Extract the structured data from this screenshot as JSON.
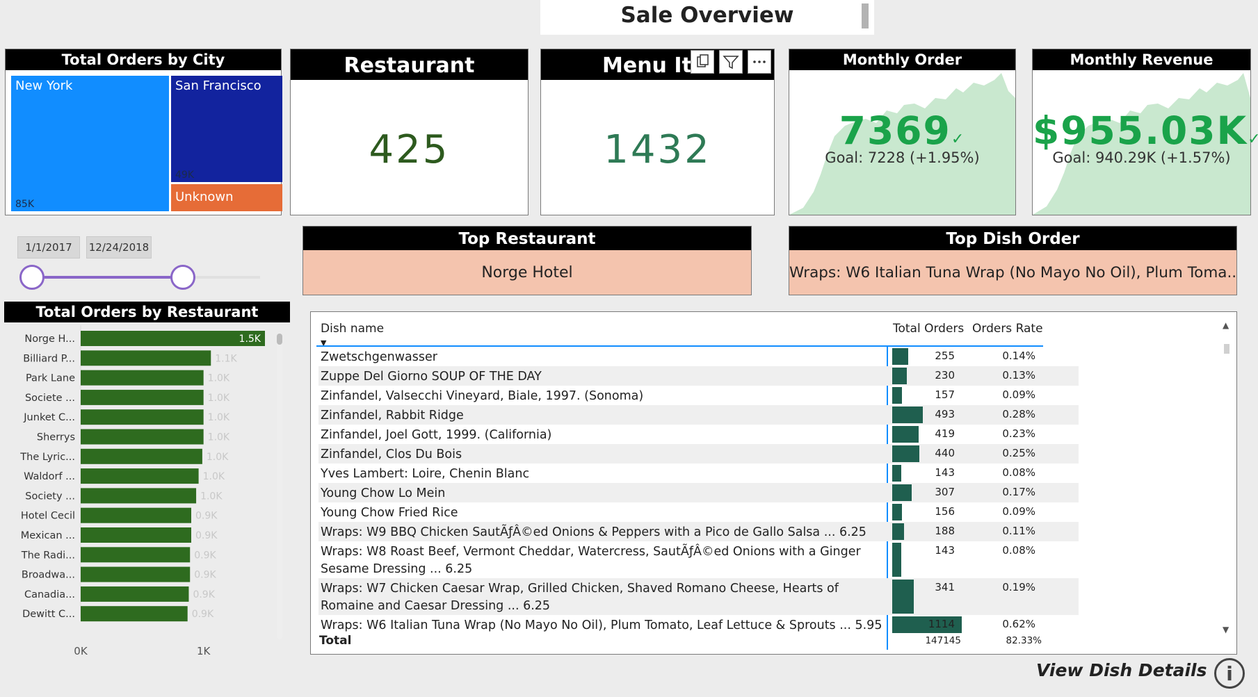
{
  "title": "Sale Overview",
  "treemap": {
    "title": "Total Orders by City",
    "cells": [
      {
        "name": "New York",
        "value": "85K",
        "color": "#118dff"
      },
      {
        "name": "San Francisco",
        "value": "49K",
        "color": "#12239e"
      },
      {
        "name": "Unknown",
        "value": "",
        "color": "#e66c37"
      }
    ]
  },
  "kpis": {
    "restaurant": {
      "label": "Restaurant",
      "value": "425"
    },
    "menu_item": {
      "label": "Menu Ite",
      "value": "1432"
    }
  },
  "toolbar": {
    "icons": [
      "copy-icon",
      "filter-icon",
      "more-options-icon"
    ]
  },
  "monthly_order": {
    "label": "Monthly Order",
    "value": "7369",
    "goal": "Goal: 7228 (+1.95%)",
    "check": "✓"
  },
  "monthly_revenue": {
    "label": "Monthly Revenue",
    "value": "$955.03K",
    "goal": "Goal: 940.29K (+1.57%)",
    "check": "✓"
  },
  "date_slicer": {
    "start": "1/1/2017",
    "end": "12/24/2018"
  },
  "top_restaurant": {
    "label": "Top Restaurant",
    "value": "Norge Hotel"
  },
  "top_dish": {
    "label": "Top Dish Order",
    "value": "Wraps: W6  Italian Tuna Wrap (No Mayo No Oil), Plum Toma..."
  },
  "chart_data": {
    "type": "bar",
    "title": "Total Orders by Restaurant",
    "orientation": "horizontal",
    "categories": [
      "Norge H...",
      "Billiard P...",
      "Park Lane",
      "Societe ...",
      "Junket C...",
      "Sherrys",
      "The Lyric...",
      "Waldorf ...",
      "Society ...",
      "Hotel Cecil",
      "Mexican ...",
      "The Radi...",
      "Broadwa...",
      "Canadia...",
      "Dewitt C..."
    ],
    "values": [
      1500,
      1060,
      1000,
      1000,
      1000,
      1000,
      990,
      960,
      940,
      900,
      900,
      890,
      890,
      880,
      870
    ],
    "data_labels": [
      "1.5K",
      "1.1K",
      "1.0K",
      "1.0K",
      "1.0K",
      "1.0K",
      "1.0K",
      "1.0K",
      "1.0K",
      "0.9K",
      "0.9K",
      "0.9K",
      "0.9K",
      "0.9K",
      "0.9K"
    ],
    "x_ticks": [
      "0K",
      "1K"
    ],
    "xlim": [
      0,
      1500
    ],
    "bar_color": "#2e6b1f"
  },
  "table": {
    "headers": {
      "dish": "Dish name",
      "orders": "Total Orders",
      "rate": "Orders Rate"
    },
    "max_orders": 1114,
    "rows": [
      {
        "dish": "Zwetschgenwasser",
        "orders": 255,
        "rate": "0.14%"
      },
      {
        "dish": "Zuppe Del Giorno SOUP OF THE DAY",
        "orders": 230,
        "rate": "0.13%"
      },
      {
        "dish": "Zinfandel, Valsecchi Vineyard, Biale, 1997. (Sonoma)",
        "orders": 157,
        "rate": "0.09%"
      },
      {
        "dish": "Zinfandel, Rabbit Ridge",
        "orders": 493,
        "rate": "0.28%"
      },
      {
        "dish": "Zinfandel, Joel Gott, 1999. (California)",
        "orders": 419,
        "rate": "0.23%"
      },
      {
        "dish": "Zinfandel, Clos Du Bois",
        "orders": 440,
        "rate": "0.25%"
      },
      {
        "dish": "Yves Lambert: Loire, Chenin Blanc",
        "orders": 143,
        "rate": "0.08%"
      },
      {
        "dish": "Young Chow Lo Mein",
        "orders": 307,
        "rate": "0.17%"
      },
      {
        "dish": "Young Chow Fried Rice",
        "orders": 156,
        "rate": "0.09%"
      },
      {
        "dish": "Wraps: W9 BBQ Chicken SautÃƒÂ©ed Onions & Peppers with a Pico de Gallo Salsa ... 6.25",
        "orders": 188,
        "rate": "0.11%"
      },
      {
        "dish": "Wraps: W8 Roast Beef, Vermont Cheddar, Watercress, SautÃƒÂ©ed Onions with a Ginger Sesame Dressing ... 6.25",
        "orders": 143,
        "rate": "0.08%"
      },
      {
        "dish": "Wraps: W7 Chicken Caesar Wrap, Grilled Chicken, Shaved Romano Cheese, Hearts of Romaine and Caesar Dressing ... 6.25",
        "orders": 341,
        "rate": "0.19%"
      },
      {
        "dish": "Wraps: W6 Italian Tuna Wrap (No Mayo No Oil), Plum Tomato, Leaf Lettuce & Sprouts ... 5.95",
        "orders": 1114,
        "rate": "0.62%"
      }
    ],
    "total": {
      "label": "Total",
      "orders": "147145",
      "rate": "82.33%"
    },
    "bar_color": "#1f5f4f"
  },
  "footer": {
    "view_details": "View Dish Details",
    "info_glyph": "i"
  }
}
